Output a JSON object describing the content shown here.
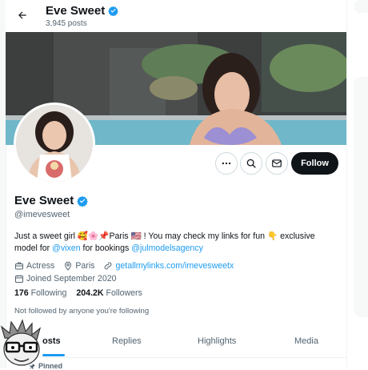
{
  "header": {
    "title": "Eve Sweet",
    "subtitle": "3,945 posts"
  },
  "profile": {
    "name": "Eve Sweet",
    "handle": "@imevesweet",
    "bio_part1": "Just a sweet girl 🥰🌸📌Paris 🇺🇸 ! You may check my links for fun 👇 exclusive model for ",
    "bio_link1": "@vixen",
    "bio_part2": " for bookings ",
    "bio_link2": "@julmodelsagency",
    "profession": "Actress",
    "location": "Paris",
    "website": "getallmylinks.com/imevesweetx",
    "joined": "Joined September 2020",
    "following_count": "176",
    "following_label": "Following",
    "followers_count": "204.2K",
    "followers_label": "Followers",
    "not_followed": "Not followed by anyone you're following"
  },
  "actions": {
    "more_icon": "more-icon",
    "search_icon": "search-icon",
    "message_icon": "mail-icon",
    "follow_label": "Follow"
  },
  "tabs": [
    {
      "label": "Posts",
      "visible": "osts"
    },
    {
      "label": "Replies",
      "visible": "Replies"
    },
    {
      "label": "Highlights",
      "visible": "Highlights"
    },
    {
      "label": "Media",
      "visible": "Media"
    }
  ],
  "pinned_label": "Pinned",
  "colors": {
    "accent": "#1d9bf0",
    "text": "#0f1419",
    "secondary": "#536471",
    "follow_bg": "#0f1419"
  }
}
